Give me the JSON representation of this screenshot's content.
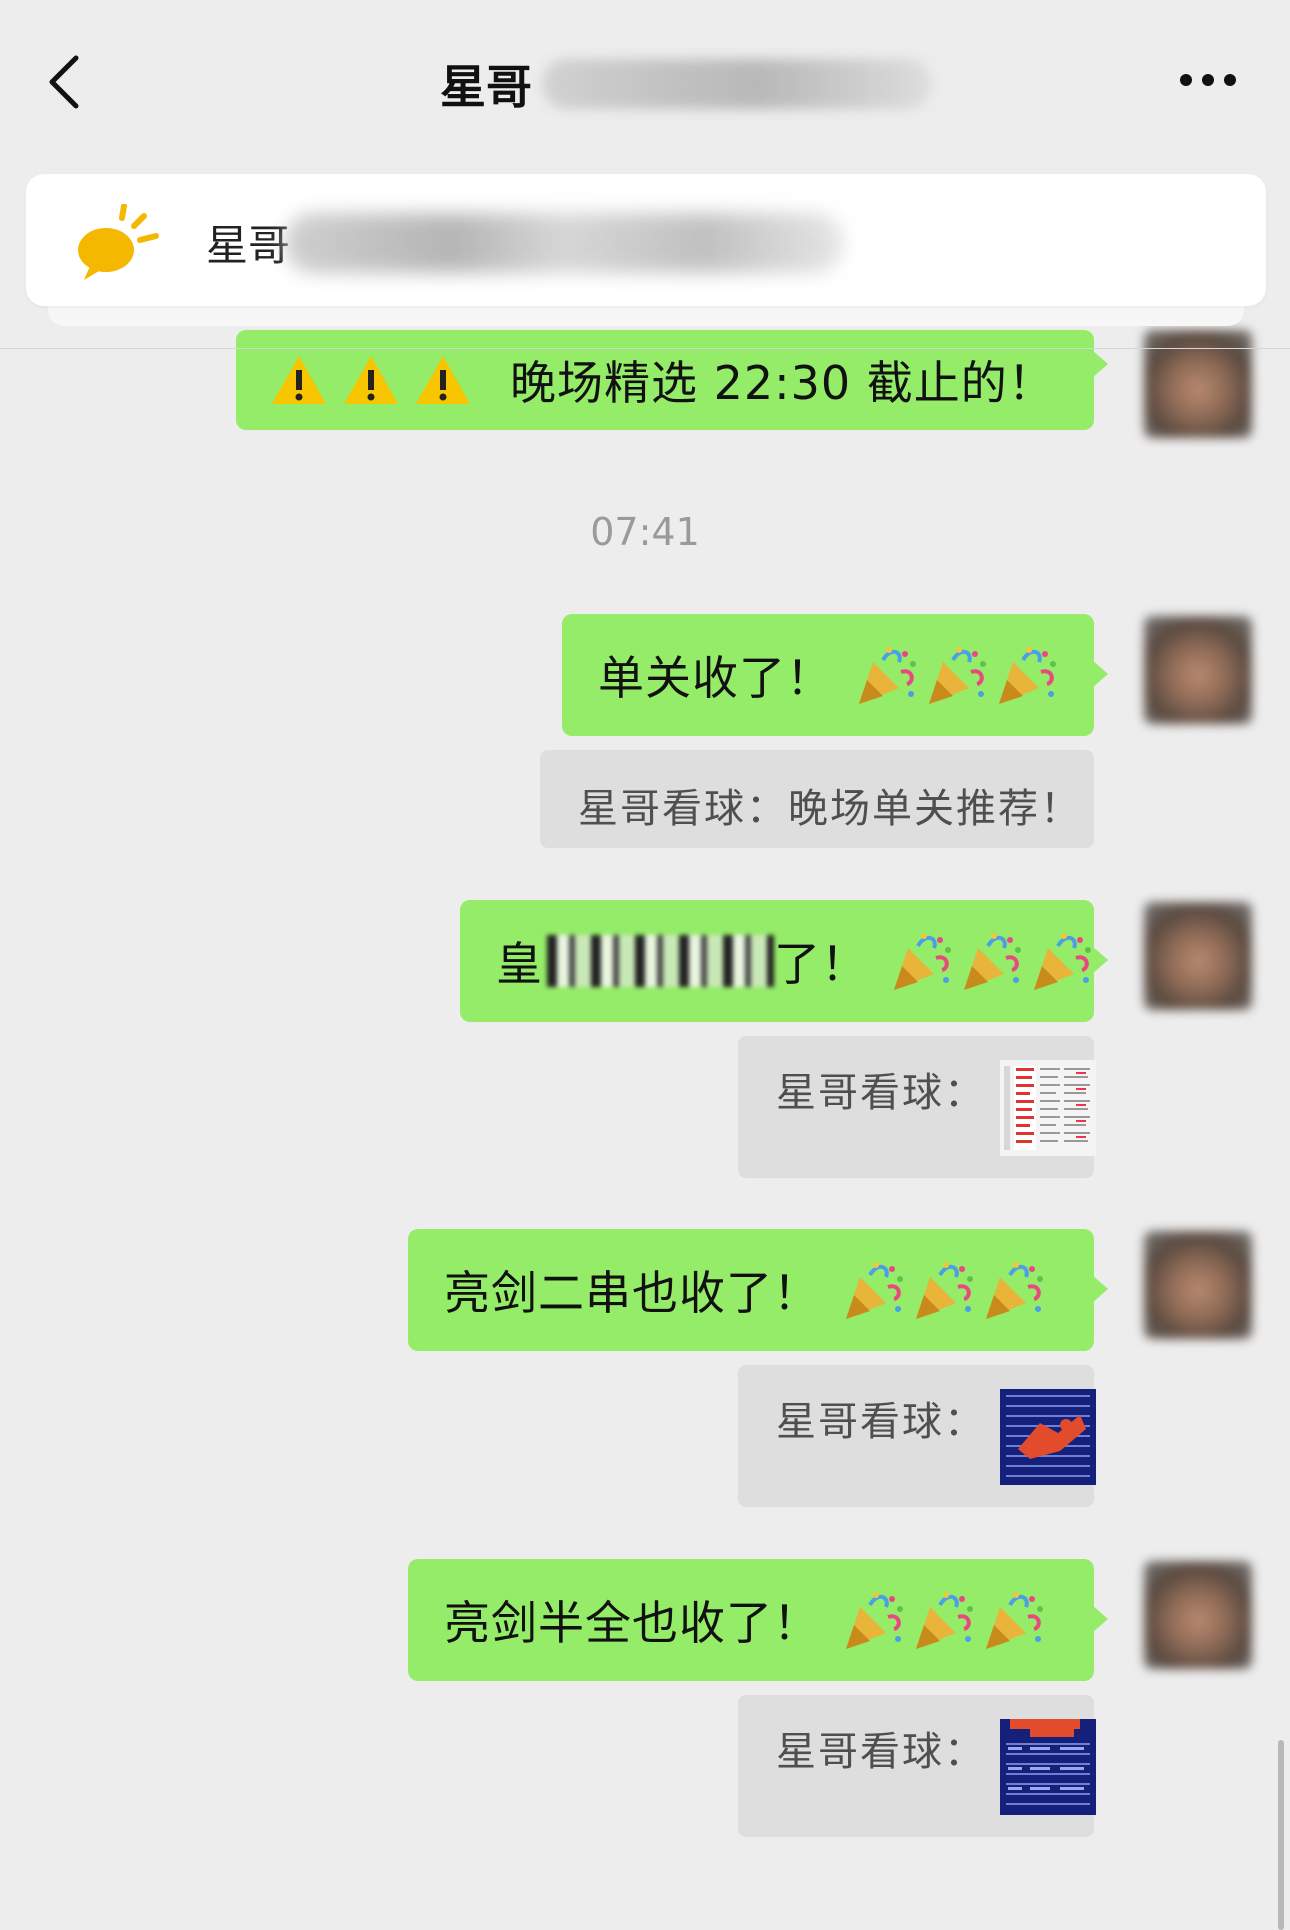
{
  "header": {
    "title": "星哥",
    "back_icon": "chevron-left-icon",
    "more_icon": "more-dots-icon"
  },
  "pinned_notice": {
    "icon": "speech-sun-icon",
    "text": "星哥"
  },
  "messages": [
    {
      "type": "text",
      "text": "晚场精选 22:30 截止的！",
      "prefix_icons": [
        "warning-icon",
        "warning-icon",
        "warning-icon"
      ]
    },
    {
      "type": "time",
      "text": "07:41"
    },
    {
      "type": "text",
      "text": "单关收了！",
      "suffix_icons": [
        "party-popper-icon",
        "party-popper-icon",
        "party-popper-icon"
      ]
    },
    {
      "type": "quote",
      "text": "星哥看球：晚场单关推荐！"
    },
    {
      "type": "text",
      "text_start": "皇",
      "text_end": "了！",
      "suffix_icons": [
        "party-popper-icon",
        "party-popper-icon",
        "party-popper-icon"
      ]
    },
    {
      "type": "quote",
      "text": "星哥看球：",
      "thumbnail": "white-table-thumbnail"
    },
    {
      "type": "text",
      "text": "亮剑二串也收了！",
      "suffix_icons": [
        "party-popper-icon",
        "party-popper-icon",
        "party-popper-icon"
      ]
    },
    {
      "type": "quote",
      "text": "星哥看球：",
      "thumbnail": "blue-table-thumbnail"
    },
    {
      "type": "text",
      "text": "亮剑半全也收了！",
      "suffix_icons": [
        "party-popper-icon",
        "party-popper-icon",
        "party-popper-icon"
      ]
    },
    {
      "type": "quote",
      "text": "星哥看球：",
      "thumbnail": "blue-table-thumbnail"
    }
  ],
  "colors": {
    "background": "#ededed",
    "bubble_green": "#95ec69",
    "quote_gray": "#dedede",
    "timestamp_gray": "#9a9a9a"
  }
}
